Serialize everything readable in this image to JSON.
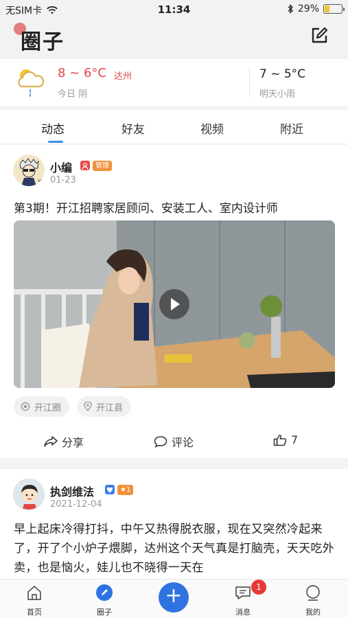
{
  "status_bar": {
    "carrier": "无SIM卡",
    "time": "11:34",
    "battery": "29%",
    "battery_level": 0.29,
    "icons": [
      "wifi-icon",
      "bluetooth-icon",
      "battery-icon"
    ]
  },
  "header": {
    "title": "圈子",
    "edit_icon": "edit-icon"
  },
  "weather": {
    "today_temp": "8 ~ 6°C",
    "city": "达州",
    "today_desc": "今日 阴",
    "tomorrow_temp": "7 ~ 5°C",
    "tomorrow_desc": "明天小雨",
    "icon": "cloudy-rain-icon",
    "accent_color": "#e04646"
  },
  "tabs": [
    {
      "label": "动态",
      "active": true
    },
    {
      "label": "好友",
      "active": false
    },
    {
      "label": "视频",
      "active": false
    },
    {
      "label": "附近",
      "active": false
    }
  ],
  "posts": [
    {
      "author": "小编",
      "role_badge": "管理",
      "date": "01-23",
      "title": "第3期！开江招聘家居顾问、安装工人、室内设计师",
      "tags": [
        "开江圈",
        "开江县"
      ],
      "actions": {
        "share": "分享",
        "comment": "评论",
        "likes": "7"
      }
    },
    {
      "author": "执剑维法",
      "level_badge": "1",
      "date": "2021-12-04",
      "text": "早上起床冷得打抖，中午又热得脱衣服，现在又突然冷起来了，开了个小炉子煨脚，达州这个天气真是打脑壳，天天吃外卖，也是恼火，娃儿也不晓得一天在"
    }
  ],
  "bottom_nav": {
    "items": [
      {
        "label": "首页",
        "icon": "home-icon"
      },
      {
        "label": "圈子",
        "icon": "circle-pen-icon"
      },
      {
        "label": "",
        "icon": "plus-icon"
      },
      {
        "label": "消息",
        "icon": "message-icon",
        "badge": "1"
      },
      {
        "label": "我的",
        "icon": "profile-icon"
      }
    ]
  },
  "colors": {
    "primary": "#2f73e0",
    "tab_indicator": "#3a8ee6",
    "badge_red": "#e53935",
    "admin_orange": "#f0903a"
  }
}
